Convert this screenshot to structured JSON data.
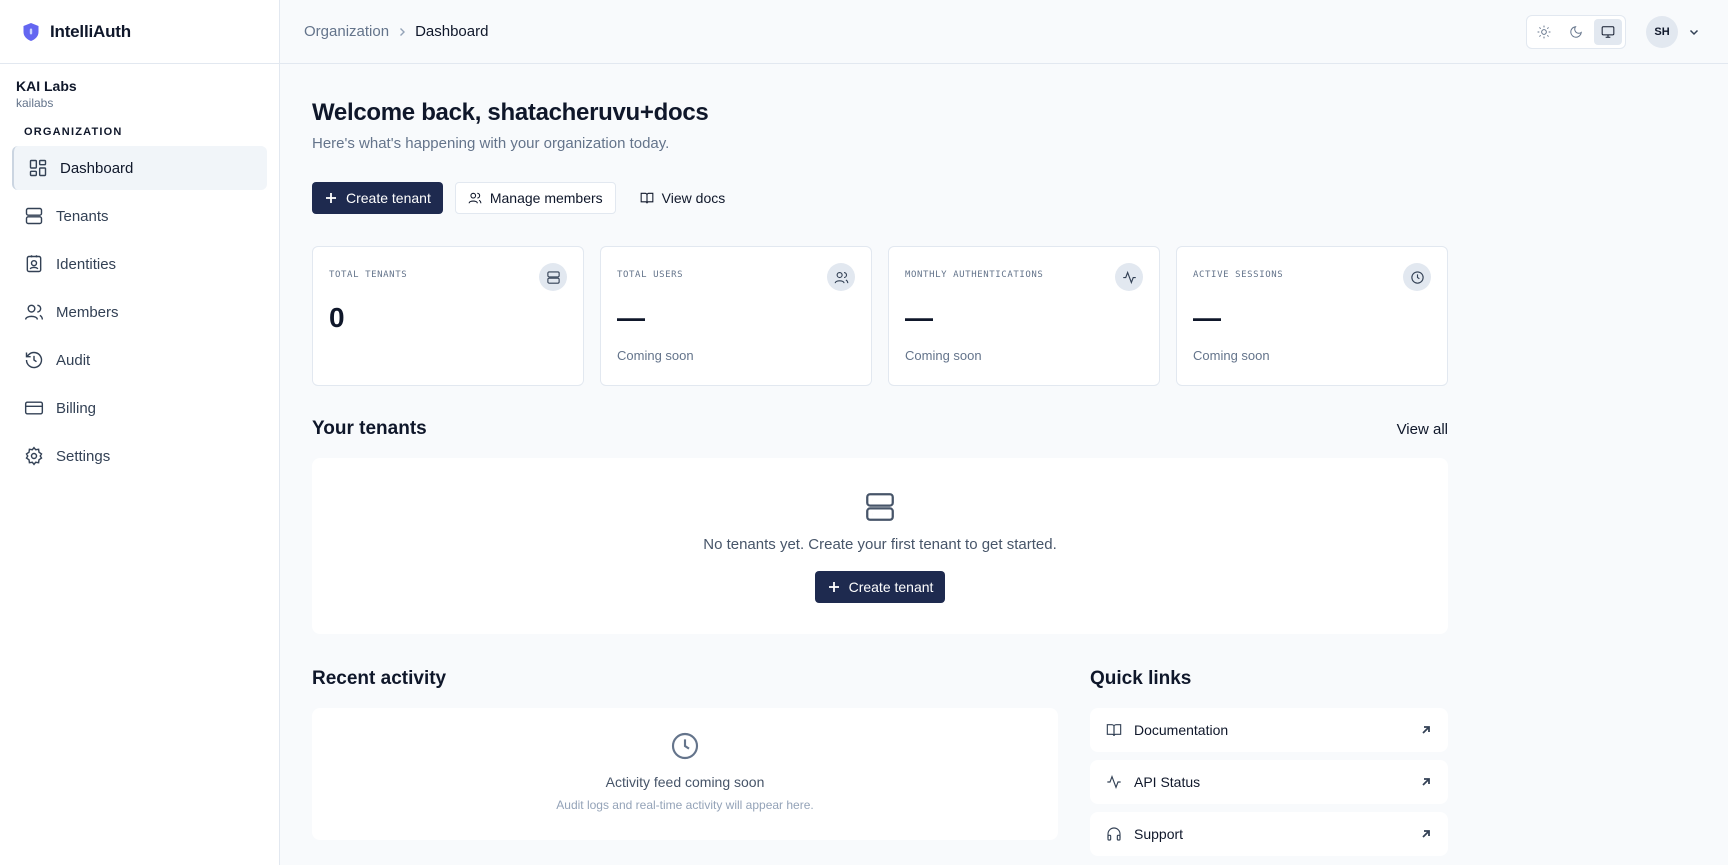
{
  "brand": {
    "name": "IntelliAuth",
    "accent": "#6366f1"
  },
  "org": {
    "name": "KAI Labs",
    "slug": "kailabs"
  },
  "sidebar": {
    "section_label": "ORGANIZATION",
    "items": [
      {
        "label": "Dashboard",
        "icon": "dashboard-icon",
        "active": true
      },
      {
        "label": "Tenants",
        "icon": "server-icon"
      },
      {
        "label": "Identities",
        "icon": "contact-icon"
      },
      {
        "label": "Members",
        "icon": "users-icon"
      },
      {
        "label": "Audit",
        "icon": "history-icon"
      },
      {
        "label": "Billing",
        "icon": "credit-card-icon"
      },
      {
        "label": "Settings",
        "icon": "gear-icon"
      }
    ]
  },
  "topbar": {
    "breadcrumb": [
      "Organization",
      "Dashboard"
    ],
    "theme_options": [
      "light",
      "dark",
      "system"
    ],
    "theme_selected": "system",
    "user_initials": "SH"
  },
  "main": {
    "welcome": "Welcome back, shatacheruvu+docs",
    "subtitle": "Here's what's happening with your organization today.",
    "actions": {
      "create": "Create tenant",
      "members": "Manage members",
      "docs": "View docs"
    },
    "stats": [
      {
        "label": "TOTAL TENANTS",
        "value": "0",
        "note": "",
        "icon": "server-icon"
      },
      {
        "label": "TOTAL USERS",
        "value": "—",
        "note": "Coming soon",
        "icon": "users-icon"
      },
      {
        "label": "MONTHLY AUTHENTICATIONS",
        "value": "—",
        "note": "Coming soon",
        "icon": "activity-icon"
      },
      {
        "label": "ACTIVE SESSIONS",
        "value": "—",
        "note": "Coming soon",
        "icon": "clock-icon"
      }
    ],
    "tenants": {
      "title": "Your tenants",
      "view_all": "View all",
      "empty_text": "No tenants yet. Create your first tenant to get started.",
      "create_label": "Create tenant"
    },
    "recent": {
      "title": "Recent activity",
      "empty_title": "Activity feed coming soon",
      "empty_sub": "Audit logs and real-time activity will appear here."
    },
    "quick": {
      "title": "Quick links",
      "items": [
        {
          "label": "Documentation",
          "icon": "book-icon"
        },
        {
          "label": "API Status",
          "icon": "activity-icon"
        },
        {
          "label": "Support",
          "icon": "headphones-icon"
        }
      ]
    }
  },
  "colors": {
    "primary": "#1e2a4f",
    "muted": "#64748b",
    "border": "#e2e8f0",
    "bg": "#f8fafc"
  }
}
